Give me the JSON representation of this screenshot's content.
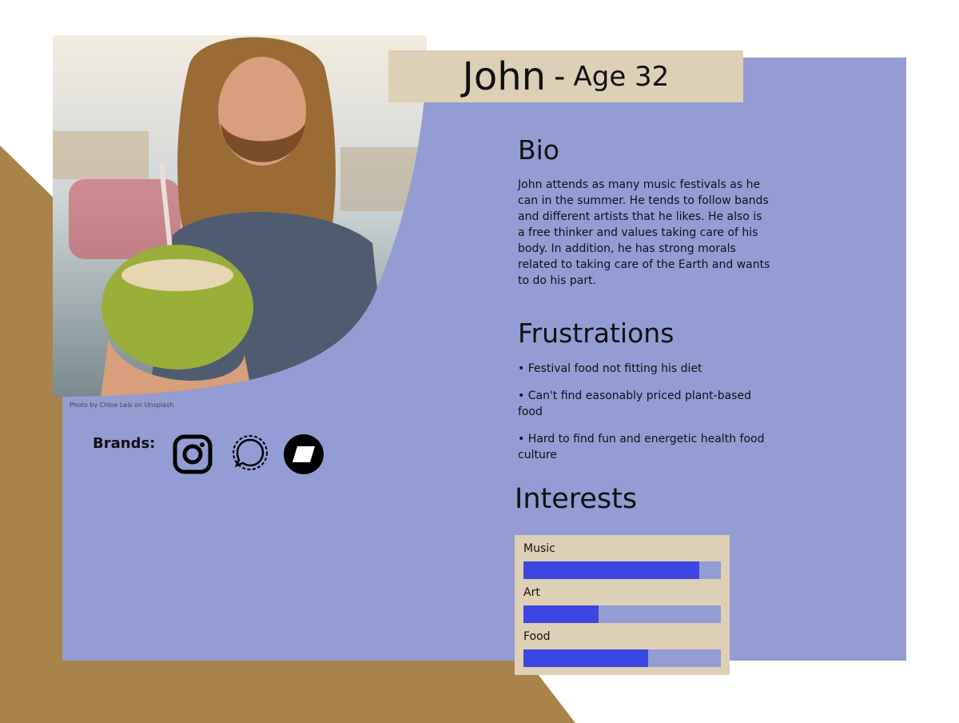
{
  "colors": {
    "gold": "#a8834a",
    "panel": "#939dd4",
    "beige": "#ddd0b6",
    "bar_fill": "#3b47e0",
    "bar_track": "#939dd4"
  },
  "persona": {
    "name": "John",
    "separator": "-",
    "age_label": "Age 32"
  },
  "photo_credit": "Photo by Chloe Leis on Unsplash",
  "bio": {
    "heading": "Bio",
    "text": "John attends as many music festivals as he can in the summer. He tends to follow bands and different artists that he likes. He also is a free thinker and values taking care of his body. In addition, he has strong morals related to taking care of the Earth and wants to do his part."
  },
  "frustrations": {
    "heading": "Frustrations",
    "items": [
      "• Festival food not fitting his diet",
      "• Can't find easonably priced plant-based food",
      "• Hard to find fun and energetic health food culture"
    ]
  },
  "brands": {
    "label": "Brands:",
    "icons": [
      "instagram-icon",
      "signal-icon",
      "squarespace-icon"
    ]
  },
  "interests": {
    "heading": "Interests",
    "items": [
      {
        "label": "Music",
        "level": 0.89
      },
      {
        "label": "Art",
        "level": 0.38
      },
      {
        "label": "Food",
        "level": 0.63
      }
    ]
  }
}
